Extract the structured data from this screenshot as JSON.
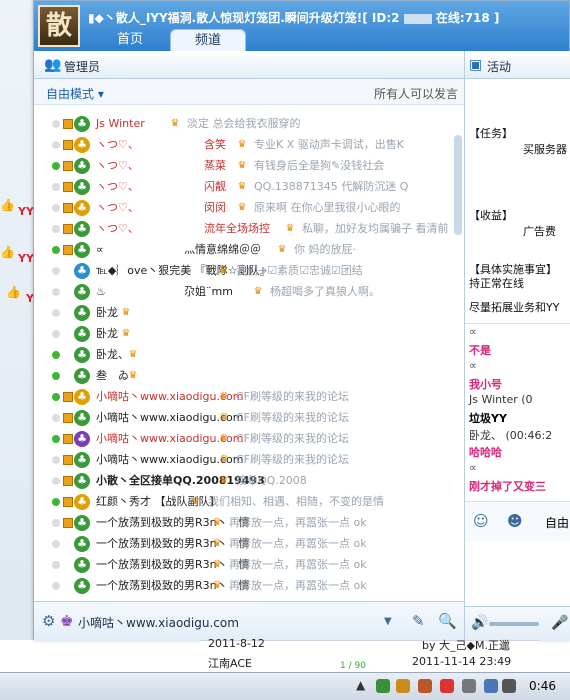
{
  "window": {
    "logo_char": "散",
    "title": "▮◆丶散人_IYY福洞.散人惊现灯笼团.瞬间升级灯笼![ ID:2",
    "title_suffix": "在线:718 ]"
  },
  "tabs": [
    {
      "label": "首页"
    },
    {
      "label": "频道"
    }
  ],
  "panel": {
    "admin_label": "管理员",
    "activity_label": "活动",
    "mode_label": "自由模式 ▾",
    "speak_label": "所有人可以发言"
  },
  "users": [
    {
      "name": "Js Winter",
      "sig": "淡定 总会给我衣服穿的",
      "online": false,
      "color": "#c9302c"
    },
    {
      "name": "ヽつ♡、",
      "mid": "含笑",
      "sig": "专业K X 驱动声卡调试，出售K",
      "online": false,
      "color": "#c9302c"
    },
    {
      "name": "ヽつ♡、",
      "mid": "蒸菜",
      "sig": "有钱身后全是狗✎没钱社会",
      "online": true,
      "color": "#c9302c"
    },
    {
      "name": "ヽつ♡、",
      "mid": "闪靓",
      "sig": "QQ.138871345 代解防沉迷 Q",
      "online": false,
      "color": "#c9302c"
    },
    {
      "name": "ヽつ♡、",
      "mid": "闵闵",
      "sig": "原来啊 在你心里我很小心眼的",
      "online": false,
      "color": "#c9302c"
    },
    {
      "name": "ヽつ♡、",
      "mid": "流年全场场控",
      "sig": "私聊，加好友均属骗子 看清前",
      "online": false,
      "color": "#c9302c"
    },
    {
      "name": "∝",
      "mid": "灬情意绵绵＠＠",
      "sig": "你 妈的放屁·",
      "online": true,
      "color": "#222"
    },
    {
      "name": "℡◆︴ove丶狠完美 『戰隊☆副队』",
      "sig": "我们→☑素质☑忠诚☑团结",
      "online": false,
      "color": "#222"
    },
    {
      "name": "♨",
      "mid": "尕姐¨mm",
      "sig": "杨超喝多了真狼人啊。",
      "online": false,
      "color": "#222"
    },
    {
      "name": "卧龙",
      "sig": "",
      "online": false,
      "color": "#222"
    },
    {
      "name": "卧龙",
      "sig": "",
      "online": false,
      "color": "#222"
    },
    {
      "name": "卧龙、",
      "sig": "",
      "online": true,
      "color": "#222"
    },
    {
      "name": "叁　ゐ",
      "sig": "",
      "online": true,
      "color": "#222"
    },
    {
      "name": "小嘀咕丶www.xiaodigu.com",
      "sig": "CF刷等级的来我的论坛",
      "online": true,
      "color": "#c9302c"
    },
    {
      "name": "小嘀咕丶www.xiaodigu.com",
      "sig": "CF刷等级的来我的论坛",
      "online": false,
      "color": "#222"
    },
    {
      "name": "小嘀咕丶www.xiaodigu.com",
      "sig": "CF刷等级的来我的论坛",
      "online": true,
      "color": "#c9302c"
    },
    {
      "name": "小嘀咕丶www.xiaodigu.com",
      "sig": "CF刷等级的来我的论坛",
      "online": false,
      "color": "#222"
    },
    {
      "name": "小散丶全区接单QQ.200819493",
      "sig": "接单QQ.2008",
      "online": false,
      "color": "#222",
      "bold": true
    },
    {
      "name": "红颜丶秀才 【战队副队】",
      "sig": "我们相知、相遇、相随，不变的是情",
      "online": true,
      "color": "#222"
    },
    {
      "name": "一个放荡到极致的男R3n丶　情",
      "sig": "再奔放一点，再嚣张一点 ok",
      "online": false,
      "color": "#222"
    },
    {
      "name": "一个放荡到极致的男R3n丶　情",
      "sig": "再奔放一点，再嚣张一点 ok",
      "online": false,
      "color": "#222"
    },
    {
      "name": "一个放荡到极致的男R3n丶　情",
      "sig": "再奔放一点，再嚣张一点 ok",
      "online": false,
      "color": "#222"
    },
    {
      "name": "一个放荡到极致的男R3n丶　情",
      "sig": "再奔放一点，再嚣张一点 ok",
      "online": false,
      "color": "#222"
    }
  ],
  "bottom": {
    "me_name": "小嘀咕丶www.xiaodigu.com"
  },
  "activity": {
    "task_label": "【任务】",
    "task_text": "买服务器",
    "income_label": "【收益】",
    "income_text": "广告费",
    "steps_label": "【具体实施事宜】",
    "steps_line1": "持正常在线",
    "steps_line2": "尽量拓展业务和YY"
  },
  "chat": [
    {
      "text": "∝",
      "color": "#555"
    },
    {
      "text": "不是",
      "color": "#d6267a"
    },
    {
      "text": "∝",
      "color": "#555"
    },
    {
      "text": "我小号",
      "color": "#d6267a"
    },
    {
      "text": "Js Winter (0",
      "color": "#333"
    },
    {
      "text": "垃圾YY",
      "color": "#000"
    },
    {
      "text": "卧龙、 (00:46:2",
      "color": "#333"
    },
    {
      "text": "哈哈哈",
      "color": "#d6267a"
    },
    {
      "text": "∝",
      "color": "#555"
    },
    {
      "text": "刚才掉了又变三",
      "color": "#d6267a"
    }
  ],
  "chat_tools": {
    "label": "自由"
  },
  "behind": {
    "date1": "2011-8-12",
    "user1": "江南ACE",
    "page": "1 / 90",
    "date2": "2011-11-14 23:49",
    "user2": "by 大_己◆M.正邋"
  },
  "taskbar": {
    "clock": "0:46"
  },
  "bg_labels": {
    "yy": "YY"
  }
}
